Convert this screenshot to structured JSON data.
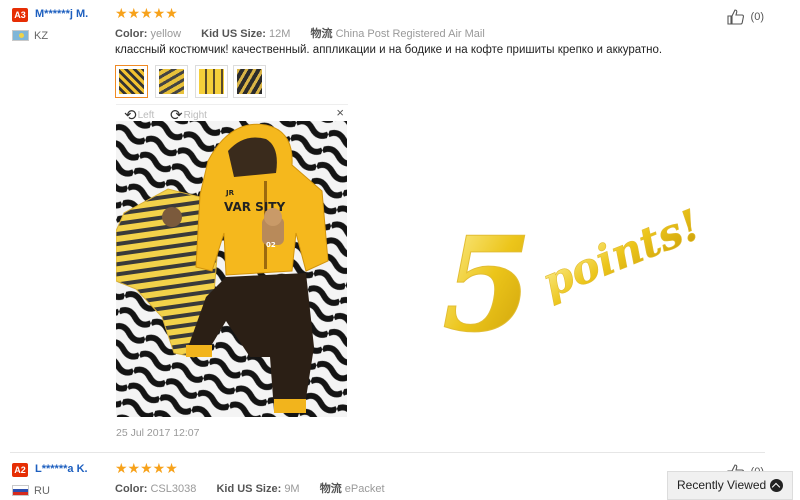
{
  "reviews": [
    {
      "badge": "A3",
      "username": "M******j M.",
      "country": "KZ",
      "stars": "★★★★★",
      "color_label": "Color:",
      "color_value": "yellow",
      "size_label": "Kid US Size:",
      "size_value": "12M",
      "shipping_label": "物流",
      "shipping_value": "China Post Registered Air Mail",
      "likes": "(0)",
      "comment": "классный костюмчик! качественный. аппликации и на бодике и на кофте пришиты крепко и аккуратно.",
      "rotate_left": "Left",
      "rotate_right": "Right",
      "close": "×",
      "date": "25 Jul 2017 12:07",
      "photo_print": "VAR SITY",
      "photo_print_small": "JR",
      "photo_number": "02"
    },
    {
      "badge": "A2",
      "username": "L******a K.",
      "country": "RU",
      "stars": "★★★★★",
      "color_label": "Color:",
      "color_value": "CSL3038",
      "size_label": "Kid US Size:",
      "size_value": "9M",
      "shipping_label": "物流",
      "shipping_value": "ePacket",
      "likes": "(0)"
    }
  ],
  "overlay": {
    "big_number": "5",
    "points_text": "points!"
  },
  "recently_viewed": "Recently Viewed",
  "colors": {
    "star": "#f7a21b",
    "badge": "#e62e04",
    "username": "#1d5fbf",
    "points_gold": "#e8c419"
  }
}
